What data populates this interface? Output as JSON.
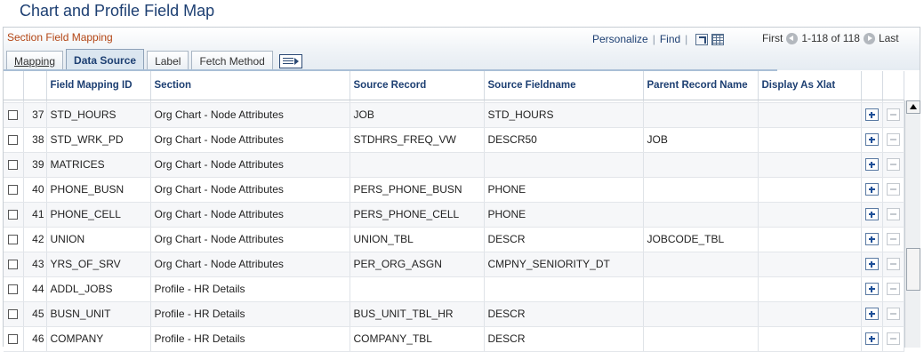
{
  "page": {
    "title": "Chart and Profile Field Map"
  },
  "grid": {
    "section_title": "Section Field Mapping",
    "nav": {
      "personalize": "Personalize",
      "find": "Find",
      "zoom_icon": "view-all-icon",
      "download_icon": "download-icon"
    },
    "pager": {
      "first": "First",
      "range": "1-118 of 118",
      "last": "Last"
    },
    "tabs": [
      {
        "label": "Mapping",
        "active": false
      },
      {
        "label": "Data Source",
        "active": true
      },
      {
        "label": "Label",
        "active": false
      },
      {
        "label": "Fetch Method",
        "active": false
      }
    ],
    "columns": {
      "id": "Field Mapping ID",
      "section": "Section",
      "record": "Source Record",
      "fieldname": "Source Fieldname",
      "parent": "Parent Record Name",
      "xlat": "Display As Xlat"
    },
    "rows": [
      {
        "num": "37",
        "id": "STD_HOURS",
        "section": "Org Chart - Node Attributes",
        "record": "JOB",
        "fieldname": "STD_HOURS",
        "parent": ""
      },
      {
        "num": "38",
        "id": "STD_WRK_PD",
        "section": "Org Chart - Node Attributes",
        "record": "STDHRS_FREQ_VW",
        "fieldname": "DESCR50",
        "parent": "JOB"
      },
      {
        "num": "39",
        "id": "MATRICES",
        "section": "Org Chart - Node Attributes",
        "record": "",
        "fieldname": "",
        "parent": ""
      },
      {
        "num": "40",
        "id": "PHONE_BUSN",
        "section": "Org Chart - Node Attributes",
        "record": "PERS_PHONE_BUSN",
        "fieldname": "PHONE",
        "parent": ""
      },
      {
        "num": "41",
        "id": "PHONE_CELL",
        "section": "Org Chart - Node Attributes",
        "record": "PERS_PHONE_CELL",
        "fieldname": "PHONE",
        "parent": ""
      },
      {
        "num": "42",
        "id": "UNION",
        "section": "Org Chart - Node Attributes",
        "record": "UNION_TBL",
        "fieldname": "DESCR",
        "parent": "JOBCODE_TBL"
      },
      {
        "num": "43",
        "id": "YRS_OF_SRV",
        "section": "Org Chart - Node Attributes",
        "record": "PER_ORG_ASGN",
        "fieldname": "CMPNY_SENIORITY_DT",
        "parent": ""
      },
      {
        "num": "44",
        "id": "ADDL_JOBS",
        "section": "Profile - HR Details",
        "record": "",
        "fieldname": "",
        "parent": ""
      },
      {
        "num": "45",
        "id": "BUSN_UNIT",
        "section": "Profile - HR Details",
        "record": "BUS_UNIT_TBL_HR",
        "fieldname": "DESCR",
        "parent": ""
      },
      {
        "num": "46",
        "id": "COMPANY",
        "section": "Profile - HR Details",
        "record": "COMPANY_TBL",
        "fieldname": "DESCR",
        "parent": ""
      }
    ]
  }
}
